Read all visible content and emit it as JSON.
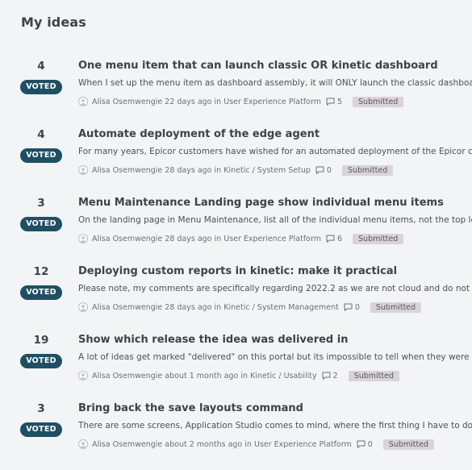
{
  "page": {
    "title": "My ideas"
  },
  "ideas": [
    {
      "votes": "4",
      "voted_label": "VOTED",
      "title": "One menu item that can launch classic OR kinetic dashboard",
      "description": "When I set up the menu item as dashboard assembly, it will ONLY launch the classic dashboard",
      "author": "Alisa Osemwengie",
      "time": "22 days ago",
      "in_label": "in",
      "category": "User Experience Platform",
      "comments": "5",
      "status": "Submitted"
    },
    {
      "votes": "4",
      "voted_label": "VOTED",
      "title": "Automate deployment of the edge agent",
      "description": "For many years, Epicor customers have wished for an automated deployment of the Epicor client",
      "author": "Alisa Osemwengie",
      "time": "28 days ago",
      "in_label": "in",
      "category": "Kinetic / System Setup",
      "comments": "0",
      "status": "Submitted"
    },
    {
      "votes": "3",
      "voted_label": "VOTED",
      "title": "Menu Maintenance Landing page show individual menu items",
      "description": "On the landing page in Menu Maintenance, list all of the individual menu items, not the top level",
      "author": "Alisa Osemwengie",
      "time": "28 days ago",
      "in_label": "in",
      "category": "User Experience Platform",
      "comments": "6",
      "status": "Submitted"
    },
    {
      "votes": "12",
      "voted_label": "VOTED",
      "title": "Deploying custom reports in kinetic: make it practical",
      "description": "Please note, my comments are specifically regarding 2022.2 as we are not cloud and do not",
      "author": "Alisa Osemwengie",
      "time": "28 days ago",
      "in_label": "in",
      "category": "Kinetic / System Management",
      "comments": "0",
      "status": "Submitted"
    },
    {
      "votes": "19",
      "voted_label": "VOTED",
      "title": "Show which release the idea was delivered in",
      "description": "A lot of ideas get marked \"delivered\" on this portal but its impossible to tell when they were d",
      "author": "Alisa Osemwengie",
      "time": "about 1 month ago",
      "in_label": "in",
      "category": "Kinetic / Usability",
      "comments": "2",
      "status": "Submitted"
    },
    {
      "votes": "3",
      "voted_label": "VOTED",
      "title": "Bring back the save layouts command",
      "description": "There are some screens, Application Studio comes to mind, where the first thing I have to do",
      "author": "Alisa Osemwengie",
      "time": "about 2 months ago",
      "in_label": "in",
      "category": "User Experience Platform",
      "comments": "0",
      "status": "Submitted"
    }
  ]
}
